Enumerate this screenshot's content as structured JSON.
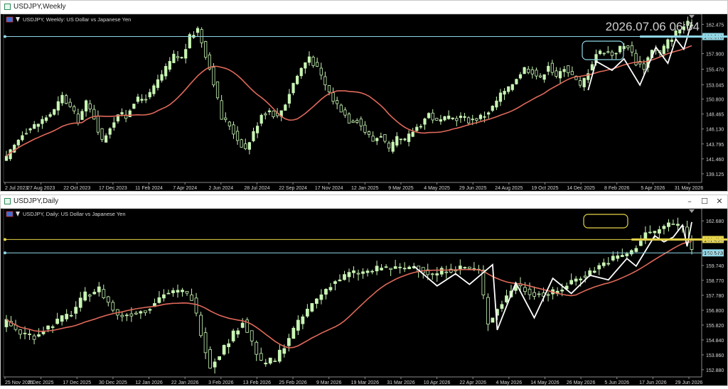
{
  "colors": {
    "bull": "#c8f5b4",
    "bear": "#c8f5b4",
    "ma": "#e0695a",
    "zigzag": "#ffffff",
    "hl_cyan": "#8fd8e8",
    "hl_yellow": "#e6d44a",
    "axis_text": "#d8d8d8",
    "price_tag_bg": "#f2f2f2"
  },
  "windows": [
    {
      "title": "USDJPY,Weekly",
      "info": "USDJPY, Weekly:  US Dollar vs Japanese Yen",
      "overlay_time": "2026.07.06 06:04",
      "y_ticks": [
        "162.475",
        "160.573",
        "157.900",
        "155.470",
        "153.045",
        "150.800",
        "148.465",
        "146.130",
        "143.795",
        "141.460",
        "139.125"
      ],
      "x_ticks": [
        "2 Jul 2023",
        "27 Aug 2023",
        "22 Oct 2023",
        "17 Dec 2023",
        "11 Feb 2024",
        "7 Apr 2024",
        "2 Jun 2024",
        "28 Jul 2024",
        "22 Sep 2024",
        "17 Nov 2024",
        "12 Jan 2025",
        "9 Mar 2025",
        "4 May 2025",
        "29 Jun 2025",
        "24 Aug 2025",
        "19 Oct 2025",
        "14 Dec 2025",
        "8 Feb 2026",
        "5 Apr 2026",
        "31 May 2026"
      ],
      "price_labels": [
        {
          "text": "160.573",
          "color": "hl_cyan"
        }
      ],
      "controls": []
    },
    {
      "title": "USDJPY,Daily",
      "info": "USDJPY, Daily:  US Dollar vs Japanese Yen",
      "overlay_time": "",
      "y_ticks": [
        "162.680",
        "161.454",
        "160.573",
        "159.740",
        "158.770",
        "157.780",
        "156.800",
        "155.820",
        "154.840",
        "153.860",
        "152.880"
      ],
      "x_ticks": [
        "25 Nov 2025",
        "5 Dec 2025",
        "17 Dec 2025",
        "30 Dec 2025",
        "12 Jan 2026",
        "22 Jan 2026",
        "3 Feb 2026",
        "13 Feb 2026",
        "25 Feb 2026",
        "9 Mar 2026",
        "19 Mar 2026",
        "31 Mar 2026",
        "10 Apr 2026",
        "22 Apr 2026",
        "4 May 2026",
        "14 May 2026",
        "26 May 2026",
        "5 Jun 2026",
        "17 Jun 2026",
        "29 Jun 2026"
      ],
      "price_labels": [
        {
          "text": "161.454",
          "color": "hl_yellow"
        },
        {
          "text": "160.573",
          "color": "hl_cyan"
        }
      ],
      "controls": [
        "–",
        "☐",
        "✕"
      ]
    }
  ],
  "chart_data": [
    {
      "type": "candlestick",
      "title": "USDJPY, Weekly:  US Dollar vs Japanese Yen",
      "symbol": "USDJPY",
      "timeframe": "Weekly",
      "ylim": [
        138.0,
        163.4
      ],
      "x_range": [
        "2 Jul 2023",
        "5 Jul 2026"
      ],
      "y_ticks": [
        162.475,
        160.573,
        157.9,
        155.47,
        153.045,
        150.8,
        148.465,
        146.13,
        143.795,
        141.46,
        139.125
      ],
      "anchors": [
        [
          0,
          141.5
        ],
        [
          4,
          145.5
        ],
        [
          8,
          147.0
        ],
        [
          12,
          149.0
        ],
        [
          14,
          151.2
        ],
        [
          16,
          149.5
        ],
        [
          18,
          147.5
        ],
        [
          20,
          150.2
        ],
        [
          22,
          148.0
        ],
        [
          24,
          144.2
        ],
        [
          26,
          146.5
        ],
        [
          28,
          148.5
        ],
        [
          30,
          148.0
        ],
        [
          32,
          150.5
        ],
        [
          34,
          150.8
        ],
        [
          36,
          151.5
        ],
        [
          38,
          153.6
        ],
        [
          40,
          155.5
        ],
        [
          42,
          157.5
        ],
        [
          44,
          157.2
        ],
        [
          46,
          160.4
        ],
        [
          48,
          161.8
        ],
        [
          50,
          157.8
        ],
        [
          52,
          153.5
        ],
        [
          54,
          147.8
        ],
        [
          56,
          146.8
        ],
        [
          58,
          144.5
        ],
        [
          60,
          143.0
        ],
        [
          62,
          145.5
        ],
        [
          64,
          148.5
        ],
        [
          66,
          149.0
        ],
        [
          68,
          148.0
        ],
        [
          70,
          150.2
        ],
        [
          72,
          153.3
        ],
        [
          74,
          155.6
        ],
        [
          76,
          157.5
        ],
        [
          78,
          155.5
        ],
        [
          80,
          153.0
        ],
        [
          82,
          150.7
        ],
        [
          84,
          149.2
        ],
        [
          86,
          147.5
        ],
        [
          88,
          147.6
        ],
        [
          90,
          145.8
        ],
        [
          92,
          144.3
        ],
        [
          94,
          145.3
        ],
        [
          96,
          142.7
        ],
        [
          98,
          144.5
        ],
        [
          100,
          144.2
        ],
        [
          102,
          145.8
        ],
        [
          104,
          147.0
        ],
        [
          106,
          148.5
        ],
        [
          108,
          147.2
        ],
        [
          110,
          147.6
        ],
        [
          112,
          147.8
        ],
        [
          114,
          148.0
        ],
        [
          116,
          147.5
        ],
        [
          118,
          147.8
        ],
        [
          120,
          148.3
        ],
        [
          122,
          149.5
        ],
        [
          124,
          151.5
        ],
        [
          126,
          152.3
        ],
        [
          128,
          154.2
        ],
        [
          130,
          155.6
        ],
        [
          132,
          155.2
        ],
        [
          134,
          153.9
        ],
        [
          136,
          156.3
        ],
        [
          138,
          154.0
        ],
        [
          140,
          155.9
        ],
        [
          142,
          154.5
        ],
        [
          144,
          152.7
        ],
        [
          146,
          155.2
        ],
        [
          148,
          157.9
        ],
        [
          150,
          158.3
        ],
        [
          152,
          157.8
        ],
        [
          154,
          158.8
        ],
        [
          156,
          159.2
        ],
        [
          158,
          156.6
        ],
        [
          160,
          155.8
        ],
        [
          162,
          158.7
        ],
        [
          164,
          157.9
        ],
        [
          166,
          159.8
        ],
        [
          168,
          161.2
        ],
        [
          170,
          162.2
        ],
        [
          172,
          162.8
        ]
      ],
      "moving_average": {
        "period": 20,
        "color": "#e0695a"
      },
      "horizontal_lines": [
        {
          "price": 160.573,
          "color": "#8fd8e8"
        }
      ],
      "zigzag_points": [
        [
          146,
          152.2
        ],
        [
          148,
          156.7
        ],
        [
          152,
          155.3
        ],
        [
          155,
          157.1
        ],
        [
          159,
          153.0
        ],
        [
          163,
          158.9
        ],
        [
          166,
          156.4
        ],
        [
          168,
          160.2
        ],
        [
          170,
          158.6
        ],
        [
          172,
          162.8
        ]
      ]
    },
    {
      "type": "candlestick",
      "title": "USDJPY, Daily:  US Dollar vs Japanese Yen",
      "symbol": "USDJPY",
      "timeframe": "Daily",
      "ylim": [
        152.5,
        163.2
      ],
      "x_range": [
        "25 Nov 2025",
        "6 Jul 2026"
      ],
      "y_ticks": [
        162.68,
        161.454,
        160.573,
        159.74,
        158.77,
        157.78,
        156.8,
        155.82,
        154.84,
        153.86,
        152.88
      ],
      "anchors": [
        [
          0,
          156.0
        ],
        [
          3,
          155.3
        ],
        [
          6,
          155.1
        ],
        [
          10,
          155.9
        ],
        [
          14,
          156.6
        ],
        [
          17,
          157.8
        ],
        [
          20,
          158.2
        ],
        [
          24,
          156.4
        ],
        [
          27,
          156.6
        ],
        [
          30,
          156.8
        ],
        [
          34,
          157.9
        ],
        [
          38,
          158.0
        ],
        [
          40,
          157.6
        ],
        [
          44,
          153.1
        ],
        [
          48,
          154.8
        ],
        [
          51,
          156.1
        ],
        [
          55,
          153.3
        ],
        [
          58,
          153.5
        ],
        [
          62,
          155.5
        ],
        [
          66,
          157.2
        ],
        [
          70,
          158.5
        ],
        [
          74,
          159.2
        ],
        [
          78,
          159.3
        ],
        [
          81,
          159.6
        ],
        [
          85,
          159.5
        ],
        [
          88,
          159.7
        ],
        [
          92,
          159.1
        ],
        [
          95,
          159.5
        ],
        [
          99,
          159.6
        ],
        [
          102,
          159.4
        ],
        [
          104,
          156.0
        ],
        [
          107,
          157.3
        ],
        [
          110,
          158.5
        ],
        [
          113,
          158.0
        ],
        [
          116,
          157.8
        ],
        [
          119,
          158.0
        ],
        [
          122,
          158.7
        ],
        [
          126,
          159.3
        ],
        [
          129,
          159.9
        ],
        [
          131,
          160.2
        ],
        [
          135,
          160.6
        ],
        [
          138,
          161.9
        ],
        [
          140,
          161.9
        ],
        [
          143,
          162.5
        ],
        [
          146,
          162.3
        ],
        [
          147,
          161.4
        ],
        [
          148,
          160.7
        ]
      ],
      "moving_average": {
        "period": 20,
        "color": "#e0695a"
      },
      "horizontal_lines": [
        {
          "price": 161.454,
          "color": "#e6d44a"
        },
        {
          "price": 160.573,
          "color": "#8fd8e8"
        }
      ],
      "zigzag_points": [
        [
          88,
          159.7
        ],
        [
          93,
          158.4
        ],
        [
          97,
          159.2
        ],
        [
          100,
          158.5
        ],
        [
          105,
          159.8
        ],
        [
          106,
          155.5
        ],
        [
          110,
          158.6
        ],
        [
          114,
          156.3
        ],
        [
          118,
          158.9
        ],
        [
          122,
          157.9
        ],
        [
          126,
          159.1
        ],
        [
          130,
          158.8
        ],
        [
          134,
          160.2
        ],
        [
          136,
          159.7
        ],
        [
          140,
          161.7
        ],
        [
          142,
          161.3
        ],
        [
          144,
          161.6
        ],
        [
          146,
          162.4
        ],
        [
          147,
          161.0
        ],
        [
          148,
          162.6
        ]
      ]
    }
  ]
}
